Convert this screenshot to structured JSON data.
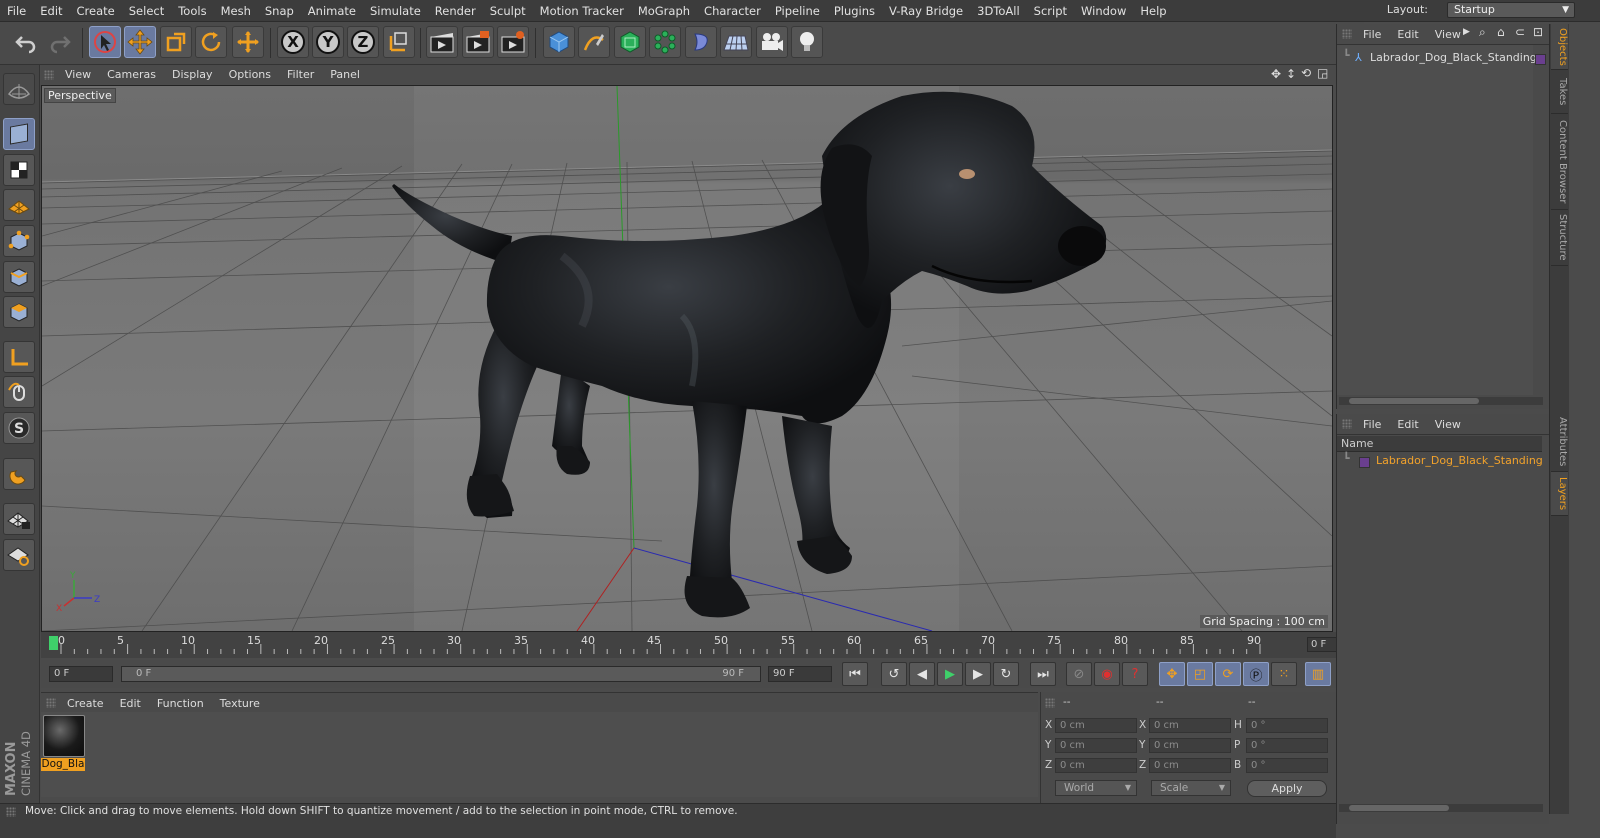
{
  "menubar": {
    "items": [
      "File",
      "Edit",
      "Create",
      "Select",
      "Tools",
      "Mesh",
      "Snap",
      "Animate",
      "Simulate",
      "Render",
      "Sculpt",
      "Motion Tracker",
      "MoGraph",
      "Character",
      "Pipeline",
      "Plugins",
      "V-Ray Bridge",
      "3DToAll",
      "Script",
      "Window",
      "Help"
    ],
    "layout_label": "Layout:",
    "layout_value": "Startup"
  },
  "toolbar": {
    "icons": [
      "undo-icon",
      "redo-icon",
      "live-select-icon",
      "move-icon",
      "scale-icon",
      "rotate-icon",
      "recent-tool-icon",
      "lock-x-icon",
      "lock-y-icon",
      "lock-z-icon",
      "coordinate-system-icon",
      "render-view-icon",
      "render-picture-viewer-icon",
      "edit-render-settings-icon",
      "cube-icon",
      "pen-spline-icon",
      "subdivision-icon",
      "array-icon",
      "deformer-icon",
      "floor-icon",
      "camera-icon",
      "light-icon"
    ],
    "axis_x": "X",
    "axis_y": "Y",
    "axis_z": "Z"
  },
  "viewport": {
    "menu": [
      "View",
      "Cameras",
      "Display",
      "Options",
      "Filter",
      "Panel"
    ],
    "camera_label": "Perspective",
    "grid_spacing": "Grid Spacing : 100 cm",
    "axis_labels": {
      "y": "Y",
      "x": "X",
      "z": "Z"
    }
  },
  "timeline": {
    "ticks": [
      "0",
      "5",
      "10",
      "15",
      "20",
      "25",
      "30",
      "35",
      "40",
      "45",
      "50",
      "55",
      "60",
      "65",
      "70",
      "75",
      "80",
      "85",
      "90"
    ],
    "current_frame": "0 F",
    "start_field": "0 F",
    "range_start": "0 F",
    "range_end": "90 F",
    "end_field": "90 F"
  },
  "material_manager": {
    "menu": [
      "Create",
      "Edit",
      "Function",
      "Texture"
    ],
    "materials": [
      {
        "name": "Dog_Bla"
      }
    ]
  },
  "branding": {
    "maxon": "MAXON",
    "product": "CINEMA 4D"
  },
  "coordinates": {
    "headers": [
      "--",
      "--",
      "--"
    ],
    "rows": [
      {
        "l1": "X",
        "v1": "0 cm",
        "l2": "X",
        "v2": "0 cm",
        "l3": "H",
        "v3": "0 °"
      },
      {
        "l1": "Y",
        "v1": "0 cm",
        "l2": "Y",
        "v2": "0 cm",
        "l3": "P",
        "v3": "0 °"
      },
      {
        "l1": "Z",
        "v1": "0 cm",
        "l2": "Z",
        "v2": "0 cm",
        "l3": "B",
        "v3": "0 °"
      }
    ],
    "mode": "World",
    "transform": "Scale",
    "apply_label": "Apply"
  },
  "objects_panel": {
    "menu": [
      "File",
      "Edit",
      "View"
    ],
    "objects": [
      {
        "name": "Labrador_Dog_Black_Standing"
      }
    ]
  },
  "layers_panel": {
    "menu": [
      "File",
      "Edit",
      "View"
    ],
    "column_name": "Name",
    "layers": [
      {
        "name": "Labrador_Dog_Black_Standing"
      }
    ]
  },
  "side_tabs": [
    "Objects",
    "Takes",
    "Content Browser",
    "Structure",
    "Attributes",
    "Layers"
  ],
  "status": {
    "text": "Move: Click and drag to move elements. Hold down SHIFT to quantize movement / add to the selection in point mode, CTRL to remove."
  },
  "colors": {
    "accent_orange": "#f0a020",
    "selected_blue": "#6a7aa0",
    "layer_purple": "#6a3f8f"
  }
}
